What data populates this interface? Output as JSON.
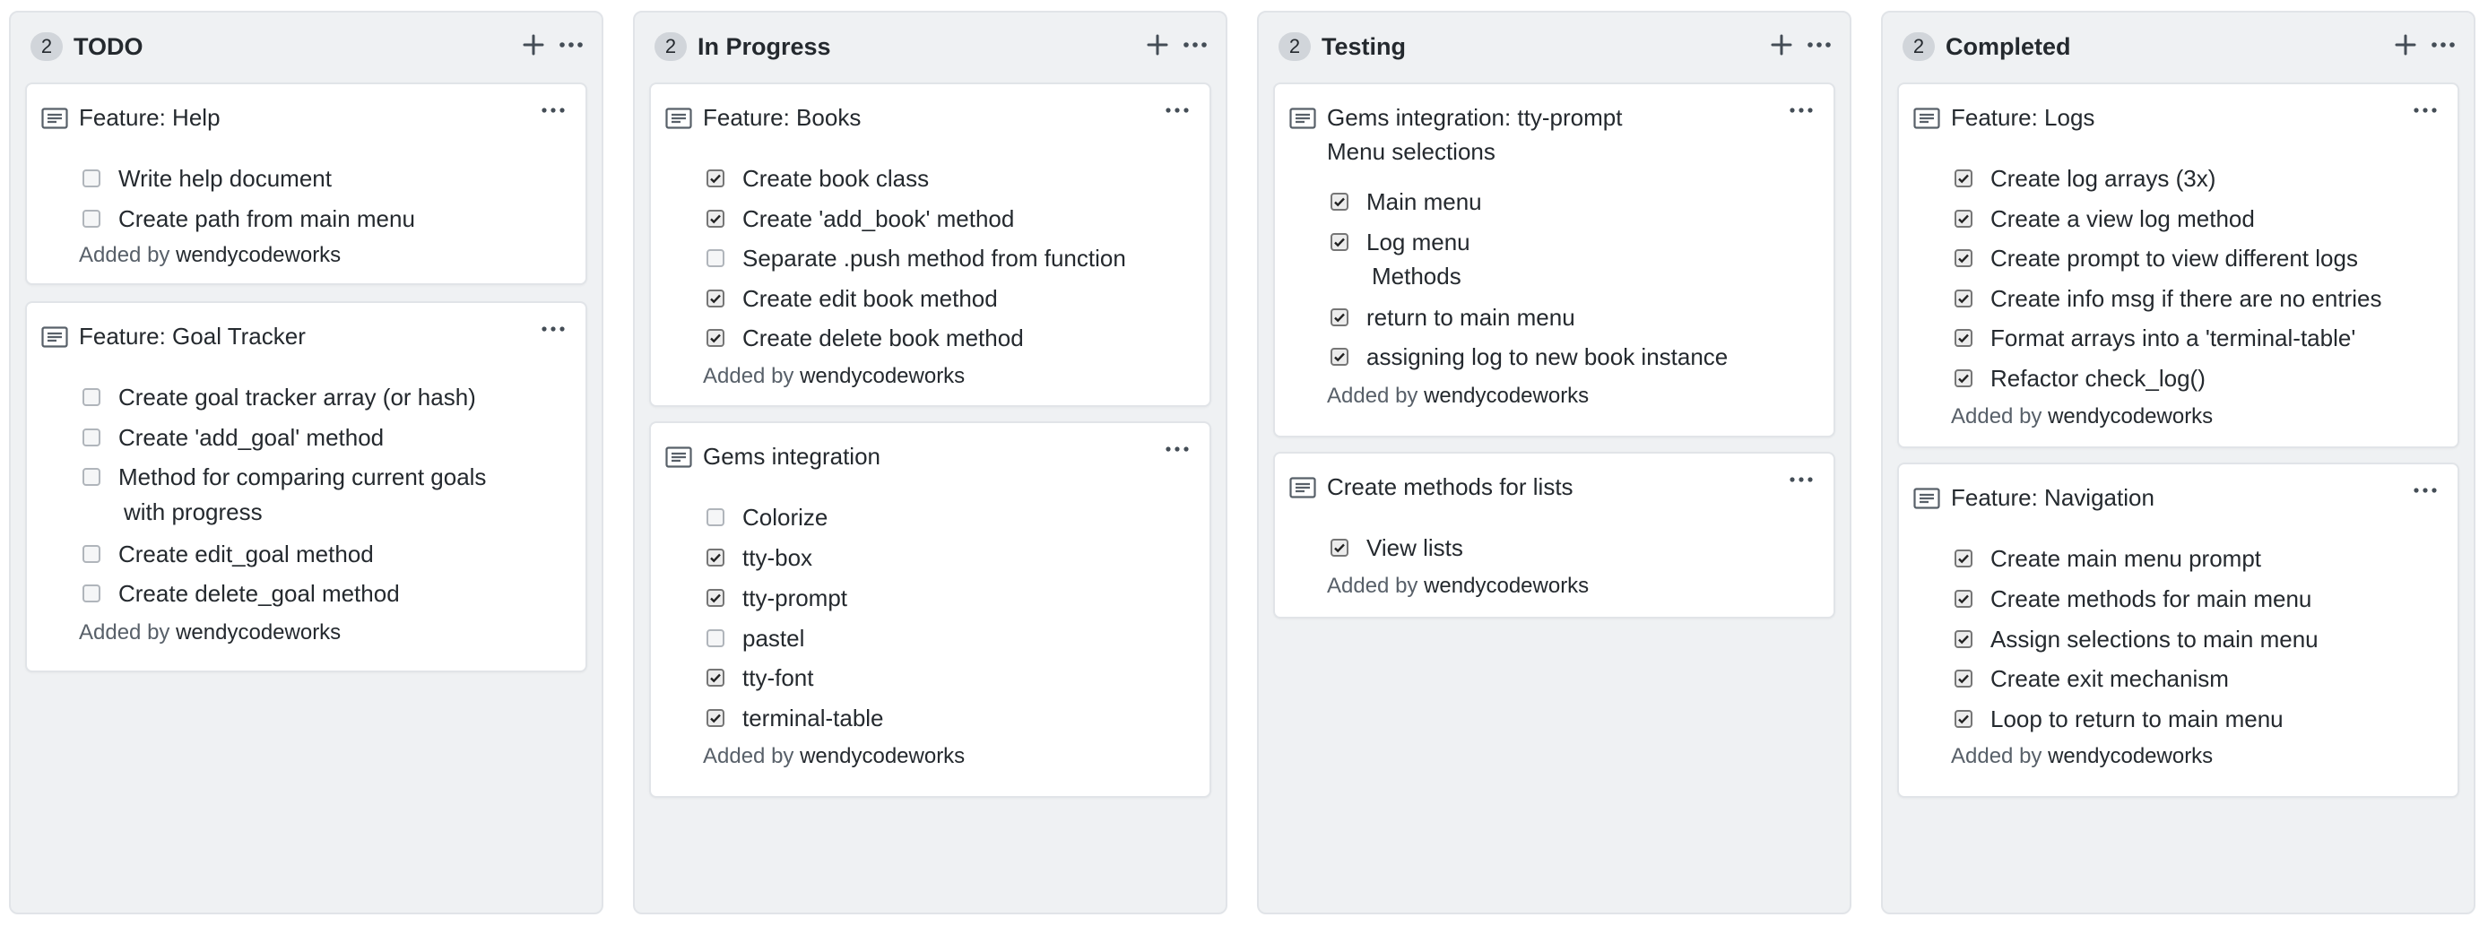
{
  "columns": [
    {
      "count": "2",
      "title": "TODO",
      "cards": [
        {
          "title": "Feature: Help",
          "items": [
            {
              "label": "Write help document",
              "checked": false
            },
            {
              "label": "Create path from main menu",
              "checked": false
            }
          ],
          "added_prefix": "Added by",
          "added_by": "wendycodeworks"
        },
        {
          "title": "Feature: Goal Tracker",
          "items": [
            {
              "label": "Create goal tracker array (or hash)",
              "checked": false
            },
            {
              "label": "Create 'add_goal' method",
              "checked": false
            },
            {
              "label": "Method for comparing current goals",
              "label2": "with progress",
              "checked": false
            },
            {
              "label": "Create edit_goal method",
              "checked": false
            },
            {
              "label": "Create delete_goal method",
              "checked": false
            }
          ],
          "added_prefix": "Added by",
          "added_by": "wendycodeworks"
        }
      ]
    },
    {
      "count": "2",
      "title": "In Progress",
      "cards": [
        {
          "title": "Feature: Books",
          "items": [
            {
              "label": "Create book class",
              "checked": true
            },
            {
              "label": "Create 'add_book' method",
              "checked": true
            },
            {
              "label": "Separate .push method from function",
              "checked": false
            },
            {
              "label": "Create edit book method",
              "checked": true
            },
            {
              "label": "Create delete book method",
              "checked": true
            }
          ],
          "added_prefix": "Added by",
          "added_by": "wendycodeworks"
        },
        {
          "title": "Gems integration",
          "items": [
            {
              "label": "Colorize",
              "checked": false
            },
            {
              "label": "tty-box",
              "checked": true
            },
            {
              "label": "tty-prompt",
              "checked": true
            },
            {
              "label": "pastel",
              "checked": false
            },
            {
              "label": "tty-font",
              "checked": true
            },
            {
              "label": "terminal-table",
              "checked": true
            }
          ],
          "added_prefix": "Added by",
          "added_by": "wendycodeworks"
        }
      ]
    },
    {
      "count": "2",
      "title": "Testing",
      "cards": [
        {
          "title": "Gems integration: tty-prompt",
          "subtitle": "Menu selections",
          "items": [
            {
              "label": "Main menu",
              "checked": true
            },
            {
              "label": "Log menu",
              "label2": "Methods",
              "checked": true
            },
            {
              "label": "return to main menu",
              "checked": true
            },
            {
              "label": "assigning log to new book instance",
              "checked": true
            }
          ],
          "added_prefix": "Added by",
          "added_by": "wendycodeworks"
        },
        {
          "title": "Create methods for lists",
          "items": [
            {
              "label": "View lists",
              "checked": true
            }
          ],
          "added_prefix": "Added by",
          "added_by": "wendycodeworks"
        }
      ]
    },
    {
      "count": "2",
      "title": "Completed",
      "cards": [
        {
          "title": "Feature: Logs",
          "items": [
            {
              "label": "Create log arrays (3x)",
              "checked": true
            },
            {
              "label": "Create a view log method",
              "checked": true
            },
            {
              "label": "Create prompt to view different logs",
              "checked": true
            },
            {
              "label": "Create info msg if there are no entries",
              "checked": true
            },
            {
              "label": "Format arrays into a 'terminal-table'",
              "checked": true
            },
            {
              "label": "Refactor check_log()",
              "checked": true
            }
          ],
          "added_prefix": "Added by",
          "added_by": "wendycodeworks"
        },
        {
          "title": "Feature: Navigation",
          "items": [
            {
              "label": "Create main menu prompt",
              "checked": true
            },
            {
              "label": "Create methods for main menu",
              "checked": true
            },
            {
              "label": "Assign selections to main menu",
              "checked": true
            },
            {
              "label": "Create exit mechanism",
              "checked": true
            },
            {
              "label": "Loop to return to main menu",
              "checked": true
            }
          ],
          "added_prefix": "Added by",
          "added_by": "wendycodeworks"
        }
      ]
    }
  ],
  "icons": {
    "add": "plus-icon",
    "menu": "kebab-icon",
    "note": "note-icon",
    "check": "check-icon"
  }
}
